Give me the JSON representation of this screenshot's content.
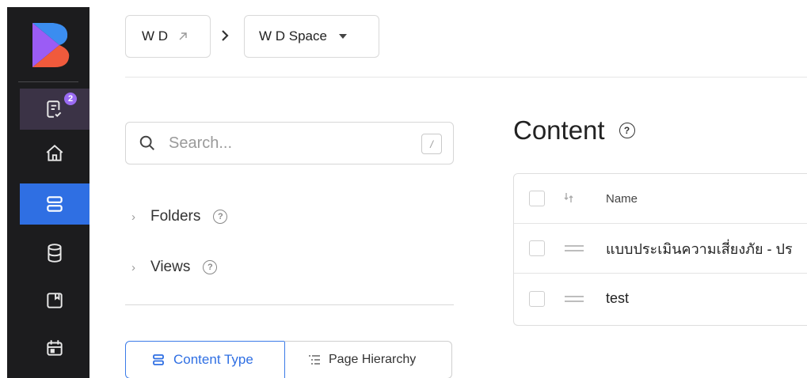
{
  "rail": {
    "badge_count": "2",
    "brand_colors": [
      "#7c5cf5",
      "#f05a3c",
      "#3b8df0"
    ]
  },
  "breadcrumb": {
    "workspace": "W D",
    "space": "W D Space"
  },
  "search": {
    "placeholder": "Search...",
    "shortcut": "/"
  },
  "sidebar": {
    "folders_label": "Folders",
    "views_label": "Views"
  },
  "view_toggle": {
    "content_type": "Content Type",
    "page_hierarchy": "Page Hierarchy"
  },
  "content": {
    "title": "Content",
    "columns": {
      "name": "Name"
    },
    "rows": [
      {
        "name": "แบบประเมินความเสี่ยงภัย - ปร"
      },
      {
        "name": "test"
      }
    ]
  },
  "colors": {
    "accent": "#2f6fe3",
    "rail_bg": "#1c1c1e",
    "badge": "#9a6bf2"
  }
}
